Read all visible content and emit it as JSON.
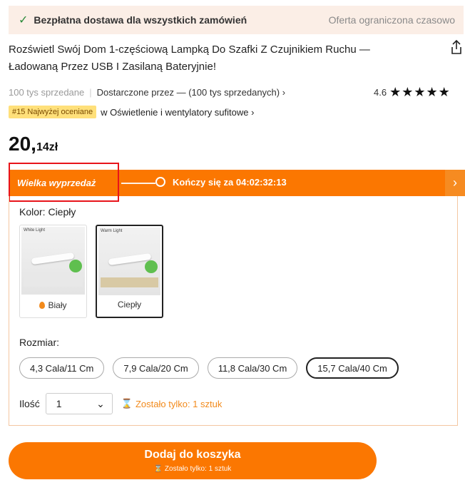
{
  "banner": {
    "left_text": "Bezpłatna dostawa dla wszystkich zamówień",
    "right_text": "Oferta ograniczona czasowo"
  },
  "product": {
    "title_line1": "Rozświetl Swój Dom 1-częściową Lampką Do Szafki Z Czujnikiem Ruchu —",
    "title_line2": "Ładowaną Przez USB I Zasilaną Bateryjnie!",
    "sold": "100 tys sprzedane",
    "delivered_by": "Dostarczone przez — (100 tys sprzedanych) ›",
    "rating": "4.6",
    "stars": "★★★★★",
    "rank_badge": "#15 Najwyżej oceniane",
    "rank_category": "w Oświetlenie i wentylatory sufitowe ›",
    "price_int": "20,",
    "price_dec": "14zł"
  },
  "sale": {
    "label": "Wielka wyprzedaż",
    "countdown": "Kończy się za 04:02:32:13",
    "arrow": "›"
  },
  "options": {
    "color_label": "Kolor: Ciepły",
    "swatches": [
      {
        "label": "Biały",
        "header": "White Light"
      },
      {
        "label": "Ciepły",
        "header": "Warm Light"
      }
    ],
    "size_label": "Rozmiar:",
    "sizes": [
      "4,3 Cala/11 Cm",
      "7,9 Cala/20 Cm",
      "11,8 Cala/30 Cm",
      "15,7 Cala/40 Cm"
    ],
    "selected_size": "15,7 Cala/40 Cm",
    "qty_label": "Ilość",
    "qty_value": "1",
    "qty_warning": "Zostało tylko: 1 sztuk"
  },
  "cart": {
    "button": "Dodaj do koszyka",
    "sub": "Zostało tylko: 1 sztuk"
  },
  "colors": {
    "accent": "#fb7701",
    "banner_bg": "#fbeee6",
    "highlight": "#e8141a"
  }
}
